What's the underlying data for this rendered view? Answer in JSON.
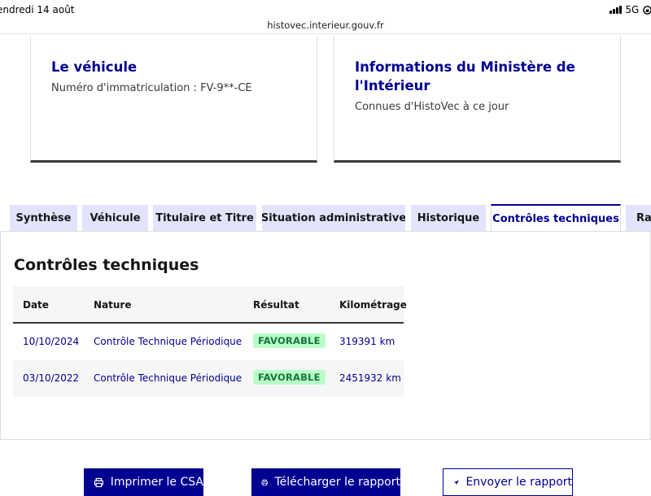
{
  "status": {
    "date": "endredi 14 août",
    "network": "5G",
    "battery": "3"
  },
  "browser": {
    "url": "histovec.interieur.gouv.fr"
  },
  "cards": [
    {
      "title": "Le véhicule",
      "text": "Numéro d'immatriculation : FV-9**-CE"
    },
    {
      "title": "Informations du Ministère de l'Intérieur",
      "text": "Connues d'HistoVec à ce jour"
    }
  ],
  "tabs": [
    {
      "label": "Synthèse"
    },
    {
      "label": "Véhicule"
    },
    {
      "label": "Titulaire et Titre"
    },
    {
      "label": "Situation administrative"
    },
    {
      "label": "Historique"
    },
    {
      "label": "Contrôles techniques",
      "active": true
    },
    {
      "label": "Rap"
    }
  ],
  "section": {
    "title": "Contrôles techniques"
  },
  "table": {
    "headers": [
      "Date",
      "Nature",
      "Résultat",
      "Kilométrage"
    ],
    "rows": [
      {
        "date": "10/10/2024",
        "nature": "Contrôle Technique Périodique",
        "result": "FAVORABLE",
        "km": "319391 km"
      },
      {
        "date": "03/10/2022",
        "nature": "Contrôle Technique Périodique",
        "result": "FAVORABLE",
        "km": "2451932 km"
      }
    ]
  },
  "buttons": {
    "print": "Imprimer le CSA",
    "download": "Télécharger le rapport",
    "send": "Envoyer le rapport"
  },
  "colors": {
    "primary": "#000091",
    "tab_bg": "#e3e3fd",
    "success_bg": "#b8fec9",
    "success_text": "#18753c"
  },
  "icons": [
    "signal-icon",
    "lock-rotation-icon",
    "printer-icon",
    "send-icon"
  ]
}
